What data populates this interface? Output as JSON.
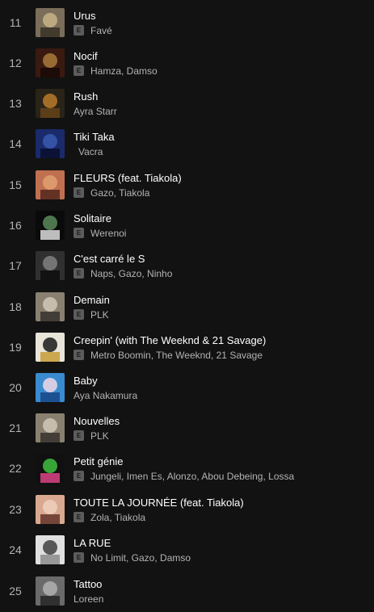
{
  "tracks": [
    {
      "num": "11",
      "title": "Urus",
      "explicit": "E",
      "artists": "Favé",
      "colors": [
        "#7a6e5a",
        "#c8b48a",
        "#3b3428"
      ]
    },
    {
      "num": "12",
      "title": "Nocif",
      "explicit": "E",
      "artists": "Hamza, Damso",
      "colors": [
        "#3a1a10",
        "#a87a3a",
        "#1a0a06"
      ]
    },
    {
      "num": "13",
      "title": "Rush",
      "explicit": "",
      "artists": "Ayra Starr",
      "colors": [
        "#2a2418",
        "#b87a2a",
        "#604018"
      ]
    },
    {
      "num": "14",
      "title": "Tiki Taka",
      "explicit": "",
      "artists": "Vacra",
      "colors": [
        "#1a2a6a",
        "#3a5ab0",
        "#0a1030"
      ]
    },
    {
      "num": "15",
      "title": "FLEURS (feat. Tiakola)",
      "explicit": "E",
      "artists": "Gazo, Tiakola",
      "colors": [
        "#c07050",
        "#e0a070",
        "#5a2a20"
      ]
    },
    {
      "num": "16",
      "title": "Solitaire",
      "explicit": "E",
      "artists": "Werenoi",
      "colors": [
        "#0a0a0a",
        "#5a8a5a",
        "#d0d0d0"
      ]
    },
    {
      "num": "17",
      "title": "C'est carré le S",
      "explicit": "E",
      "artists": "Naps, Gazo, Ninho",
      "colors": [
        "#303030",
        "#808080",
        "#101010"
      ]
    },
    {
      "num": "18",
      "title": "Demain",
      "explicit": "E",
      "artists": "PLK",
      "colors": [
        "#8a8070",
        "#d0c8b8",
        "#3a3530"
      ]
    },
    {
      "num": "19",
      "title": "Creepin' (with The Weeknd & 21 Savage)",
      "explicit": "E",
      "artists": "Metro Boomin, The Weeknd, 21 Savage",
      "colors": [
        "#e8e4d8",
        "#1a1a1a",
        "#c8a040"
      ]
    },
    {
      "num": "20",
      "title": "Baby",
      "explicit": "",
      "artists": "Aya Nakamura",
      "colors": [
        "#3a8ad0",
        "#f0d8e8",
        "#1a4a8a"
      ]
    },
    {
      "num": "21",
      "title": "Nouvelles",
      "explicit": "E",
      "artists": "PLK",
      "colors": [
        "#8a8070",
        "#d0c8b8",
        "#3a3530"
      ]
    },
    {
      "num": "22",
      "title": "Petit génie",
      "explicit": "E",
      "artists": "Jungeli, Imen Es, Alonzo, Abou Debeing, Lossa",
      "colors": [
        "#101010",
        "#40c040",
        "#d04080"
      ]
    },
    {
      "num": "23",
      "title": "TOUTE LA JOURNÉE (feat. Tiakola)",
      "explicit": "E",
      "artists": "Zola, Tiakola",
      "colors": [
        "#d8a890",
        "#f0d0c0",
        "#6a3a30"
      ]
    },
    {
      "num": "24",
      "title": "LA RUE",
      "explicit": "E",
      "artists": "No Limit, Gazo, Damso",
      "colors": [
        "#e0e0e0",
        "#404040",
        "#909090"
      ]
    },
    {
      "num": "25",
      "title": "Tattoo",
      "explicit": "",
      "artists": "Loreen",
      "colors": [
        "#6a6a6a",
        "#b0b0b0",
        "#2a2a2a"
      ]
    }
  ]
}
